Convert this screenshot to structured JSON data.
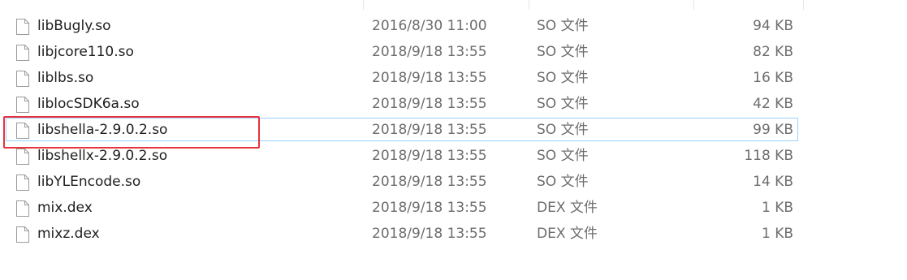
{
  "files": [
    {
      "name": "libBugly.so",
      "modified": "2016/8/30 11:00",
      "type": "SO 文件",
      "size": "94 KB",
      "icon": "file-icon"
    },
    {
      "name": "libjcore110.so",
      "modified": "2018/9/18 13:55",
      "type": "SO 文件",
      "size": "82 KB",
      "icon": "file-icon"
    },
    {
      "name": "liblbs.so",
      "modified": "2018/9/18 13:55",
      "type": "SO 文件",
      "size": "16 KB",
      "icon": "file-icon"
    },
    {
      "name": "liblocSDK6a.so",
      "modified": "2018/9/18 13:55",
      "type": "SO 文件",
      "size": "42 KB",
      "icon": "file-icon"
    },
    {
      "name": "libshella-2.9.0.2.so",
      "modified": "2018/9/18 13:55",
      "type": "SO 文件",
      "size": "99 KB",
      "icon": "file-icon"
    },
    {
      "name": "libshellx-2.9.0.2.so",
      "modified": "2018/9/18 13:55",
      "type": "SO 文件",
      "size": "118 KB",
      "icon": "file-icon"
    },
    {
      "name": "libYLEncode.so",
      "modified": "2018/9/18 13:55",
      "type": "SO 文件",
      "size": "14 KB",
      "icon": "file-icon"
    },
    {
      "name": "mix.dex",
      "modified": "2018/9/18 13:55",
      "type": "DEX 文件",
      "size": "1 KB",
      "icon": "file-icon"
    },
    {
      "name": "mixz.dex",
      "modified": "2018/9/18 13:55",
      "type": "DEX 文件",
      "size": "1 KB",
      "icon": "file-icon"
    }
  ],
  "selected_index": 4,
  "colors": {
    "selection_border": "#99d1ff",
    "annotation_red": "#e8323c",
    "name_text": "#1e1e1e",
    "detail_text": "#6d6d6d"
  }
}
